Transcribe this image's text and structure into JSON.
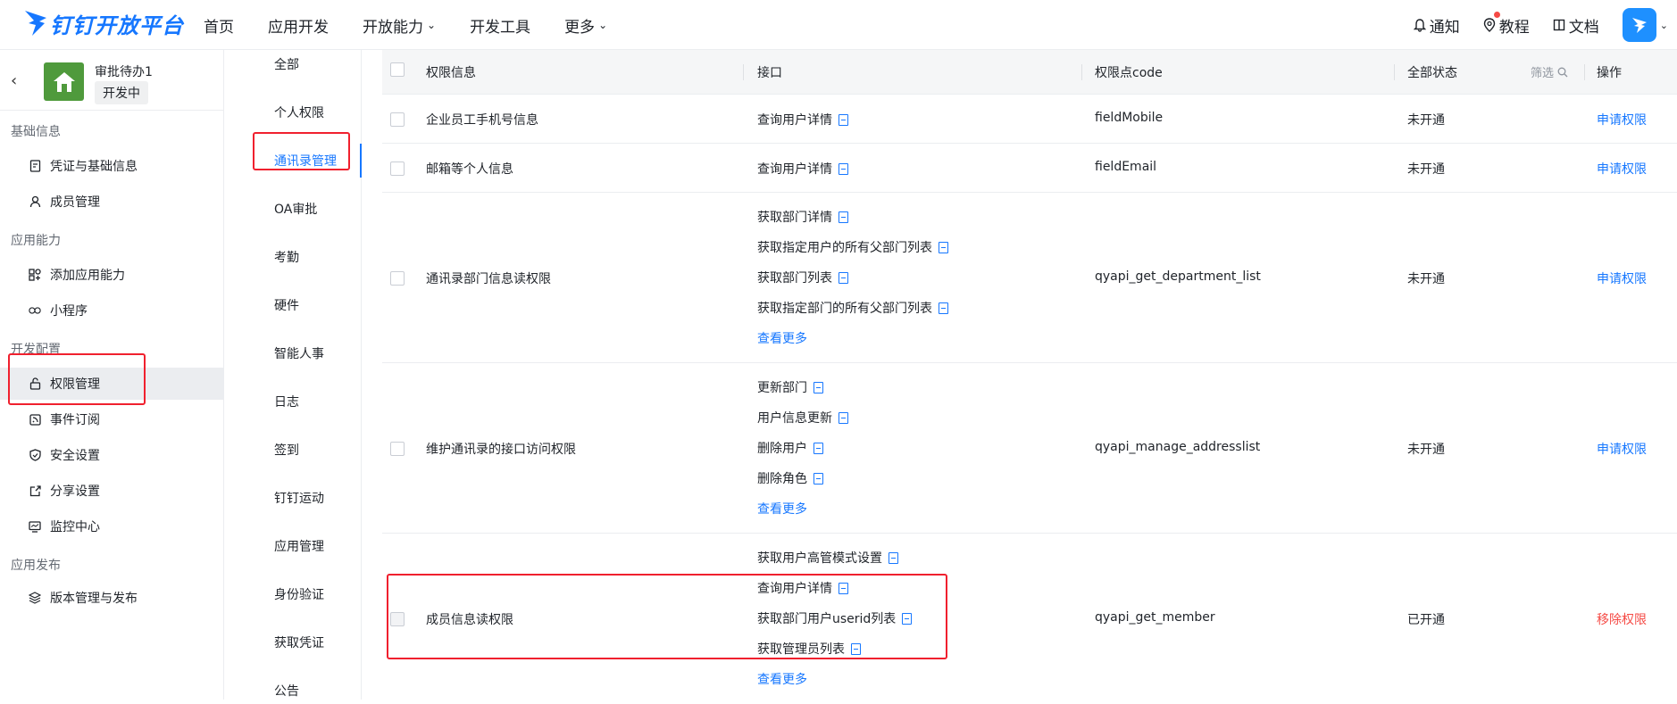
{
  "header": {
    "logo_text": "钉钉开放平台",
    "nav": [
      "首页",
      "应用开发",
      "开放能力",
      "开发工具",
      "更多"
    ],
    "right": {
      "notify": "通知",
      "tutorial": "教程",
      "docs": "文档"
    }
  },
  "app": {
    "name": "审批待办1",
    "status": "开发中"
  },
  "sidebar": {
    "sections": [
      "基础信息",
      "应用能力",
      "开发配置",
      "应用发布"
    ],
    "items": [
      "凭证与基础信息",
      "成员管理",
      "添加应用能力",
      "小程序",
      "权限管理",
      "事件订阅",
      "安全设置",
      "分享设置",
      "监控中心",
      "版本管理与发布"
    ]
  },
  "categories": [
    "全部",
    "个人权限",
    "通讯录管理",
    "OA审批",
    "考勤",
    "硬件",
    "智能人事",
    "日志",
    "签到",
    "钉钉运动",
    "应用管理",
    "身份验证",
    "获取凭证",
    "公告"
  ],
  "table": {
    "headers": {
      "info": "权限信息",
      "api": "接口",
      "code": "权限点code",
      "status": "全部状态",
      "filter": "筛选",
      "action": "操作"
    },
    "rows": [
      {
        "info": "企业员工手机号信息",
        "apis": [
          "查询用户详情"
        ],
        "more": "",
        "code": "fieldMobile",
        "status": "未开通",
        "action": "申请权限"
      },
      {
        "info": "邮箱等个人信息",
        "apis": [
          "查询用户详情"
        ],
        "more": "",
        "code": "fieldEmail",
        "status": "未开通",
        "action": "申请权限"
      },
      {
        "info": "通讯录部门信息读权限",
        "apis": [
          "获取部门详情",
          "获取指定用户的所有父部门列表",
          "获取部门列表",
          "获取指定部门的所有父部门列表"
        ],
        "more": "查看更多",
        "code": "qyapi_get_department_list",
        "status": "未开通",
        "action": "申请权限"
      },
      {
        "info": "维护通讯录的接口访问权限",
        "apis": [
          "更新部门",
          "用户信息更新",
          "删除用户",
          "删除角色"
        ],
        "more": "查看更多",
        "code": "qyapi_manage_addresslist",
        "status": "未开通",
        "action": "申请权限"
      },
      {
        "info": "成员信息读权限",
        "apis": [
          "获取用户高管模式设置",
          "查询用户详情",
          "获取部门用户userid列表",
          "获取管理员列表"
        ],
        "more": "查看更多",
        "code": "qyapi_get_member",
        "status": "已开通",
        "action": "移除权限"
      }
    ]
  },
  "colors": {
    "primary": "#1677ff",
    "danger": "#f54a45",
    "highlight": "#f0202e"
  }
}
